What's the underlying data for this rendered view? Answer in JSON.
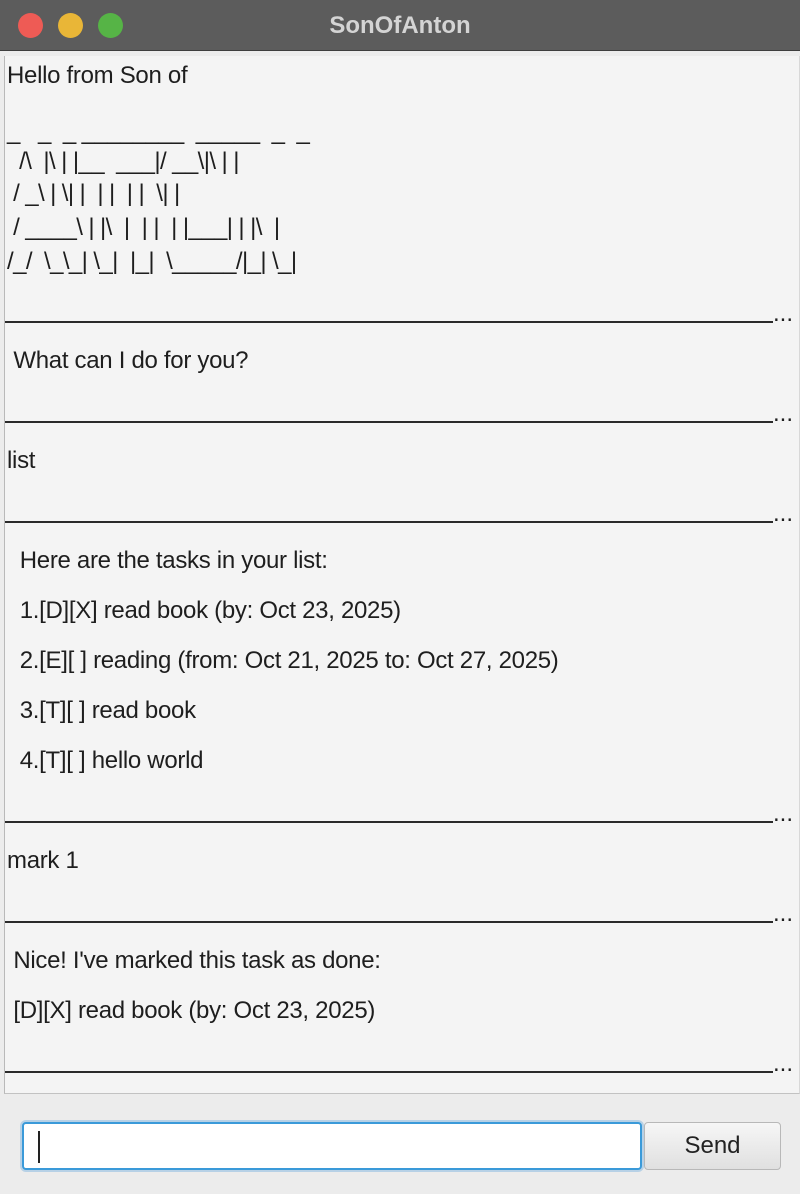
{
  "window": {
    "title": "SonOfAnton"
  },
  "chat": {
    "greeting": "Hello from Son of",
    "logo_lines": [
      "_   _  _ ________  _____  _  _",
      "  /\\  |\\ | |__  ___|/ __\\|\\ | |",
      " / _\\ | \\| |  | |  | |  \\| |",
      " / ____\\ | |\\  |  | |  | |___| | |\\  |",
      "/_/  \\_\\_| \\_|  |_|  \\_____/|_| \\_|"
    ],
    "separator_tail": "...",
    "prompt": " What can I do for you?",
    "user_list": "list",
    "list_reply": [
      "  Here are the tasks in your list:",
      "  1.[D][X] read book (by: Oct 23, 2025)",
      "  2.[E][ ] reading (from: Oct 21, 2025 to: Oct 27, 2025)",
      "  3.[T][ ] read book",
      "  4.[T][ ] hello world"
    ],
    "user_mark": "mark 1",
    "mark_reply": [
      " Nice! I've marked this task as done:",
      " [D][X] read book (by: Oct 23, 2025)"
    ]
  },
  "input": {
    "value": "",
    "placeholder": ""
  },
  "send_button": {
    "label": "Send"
  }
}
